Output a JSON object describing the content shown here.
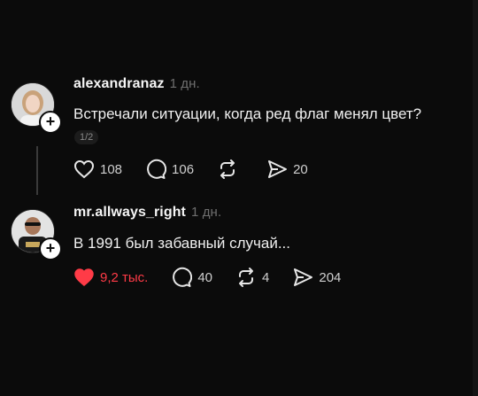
{
  "posts": [
    {
      "username": "alexandranaz",
      "time": "1 дн.",
      "text": "Встречали ситуации, когда ред флаг менял цвет?",
      "pager": "1/2",
      "actions": {
        "likes": "108",
        "comments": "106",
        "reposts": "",
        "shares": "20"
      },
      "liked": false
    },
    {
      "username": "mr.allways_right",
      "time": "1 дн.",
      "text": "В 1991 был забавный случай...",
      "actions": {
        "likes": "9,2 тыс.",
        "comments": "40",
        "reposts": "4",
        "shares": "204"
      },
      "liked": true
    }
  ],
  "colors": {
    "background": "#0b0b0b",
    "like_active": "#ff3b47",
    "muted": "#6f6f6f"
  },
  "icons": [
    "heart-icon",
    "comment-icon",
    "repost-icon",
    "share-icon",
    "plus-icon"
  ]
}
